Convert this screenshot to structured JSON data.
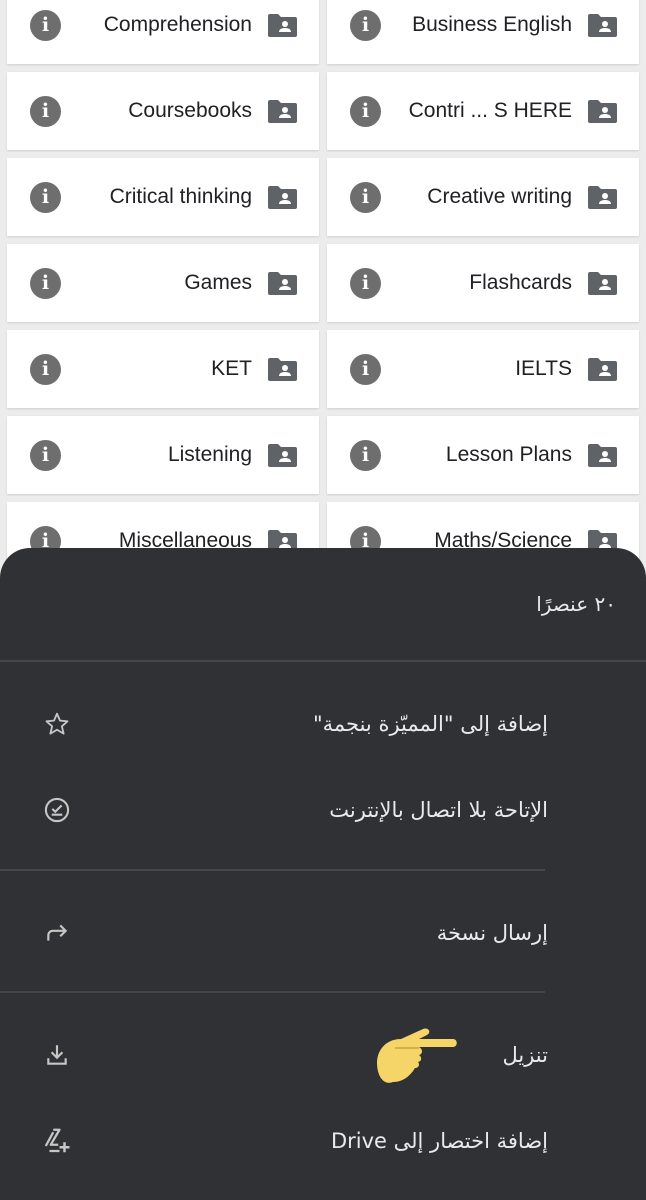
{
  "folders": [
    {
      "left": "Comprehension",
      "right": "Business English"
    },
    {
      "left": "Coursebooks",
      "right": "Contri ... S HERE"
    },
    {
      "left": "Critical thinking",
      "right": "Creative writing"
    },
    {
      "left": "Games",
      "right": "Flashcards"
    },
    {
      "left": "KET",
      "right": "IELTS"
    },
    {
      "left": "Listening",
      "right": "Lesson Plans"
    },
    {
      "left": "Miscellaneous",
      "right": "Maths/Science"
    }
  ],
  "sheet": {
    "count": "٢٠ عنصرًا",
    "items": [
      {
        "label": "إضافة إلى \"المميّزة بنجمة\"",
        "icon": "star-outline-icon"
      },
      {
        "label": "الإتاحة بلا اتصال بالإنترنت",
        "icon": "offline-check-icon"
      },
      {
        "label": "إرسال نسخة",
        "icon": "send-copy-arrow-icon"
      },
      {
        "label": "تنزيل",
        "icon": "download-icon"
      },
      {
        "label": "إضافة اختصار إلى Drive",
        "icon": "drive-add-shortcut-icon"
      }
    ]
  },
  "colors": {
    "sheet_bg": "#303134",
    "pointer_emoji": "#f5d468"
  }
}
